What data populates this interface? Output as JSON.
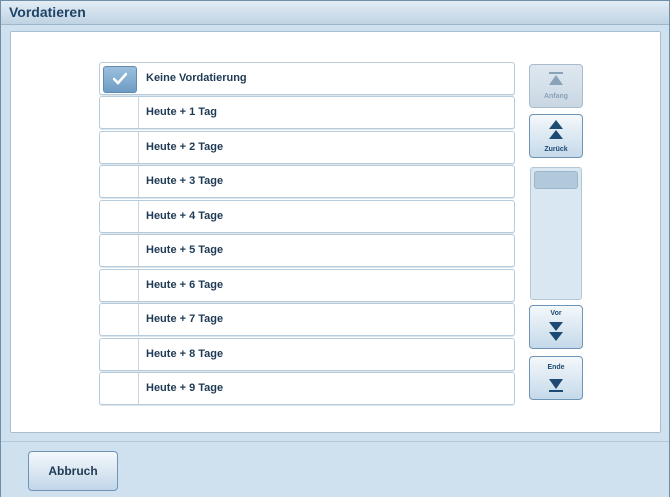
{
  "window": {
    "title": "Vordatieren"
  },
  "list": {
    "items": [
      {
        "label": "Keine Vordatierung",
        "checked": true
      },
      {
        "label": "Heute + 1 Tag",
        "checked": false
      },
      {
        "label": "Heute + 2 Tage",
        "checked": false
      },
      {
        "label": "Heute + 3 Tage",
        "checked": false
      },
      {
        "label": "Heute + 4 Tage",
        "checked": false
      },
      {
        "label": "Heute + 5 Tage",
        "checked": false
      },
      {
        "label": "Heute + 6 Tage",
        "checked": false
      },
      {
        "label": "Heute + 7 Tage",
        "checked": false
      },
      {
        "label": "Heute + 8 Tage",
        "checked": false
      },
      {
        "label": "Heute + 9 Tage",
        "checked": false
      }
    ]
  },
  "nav": {
    "anfang_label": "Anfang",
    "zurueck_label": "Zurück",
    "vor_label": "Vor",
    "ende_label": "Ende"
  },
  "footer": {
    "cancel_label": "Abbruch"
  },
  "colors": {
    "accent": "#1f4468",
    "check_fill": "#6e9cc3"
  },
  "icons": {
    "check": "checkmark-icon",
    "first": "first-page-icon",
    "back": "page-up-icon",
    "forward": "page-down-icon",
    "last": "last-page-icon"
  }
}
